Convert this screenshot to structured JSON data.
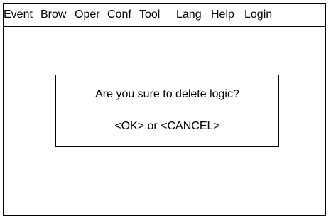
{
  "menubar": {
    "items": [
      {
        "label": "Event"
      },
      {
        "label": "Brow"
      },
      {
        "label": "Oper"
      },
      {
        "label": "Conf"
      },
      {
        "label": "Tool"
      },
      {
        "label": "Lang"
      },
      {
        "label": "Help"
      },
      {
        "label": "Login"
      }
    ]
  },
  "dialog": {
    "message": "Are you sure to delete logic?",
    "actions": "<OK> or <CANCEL>"
  }
}
